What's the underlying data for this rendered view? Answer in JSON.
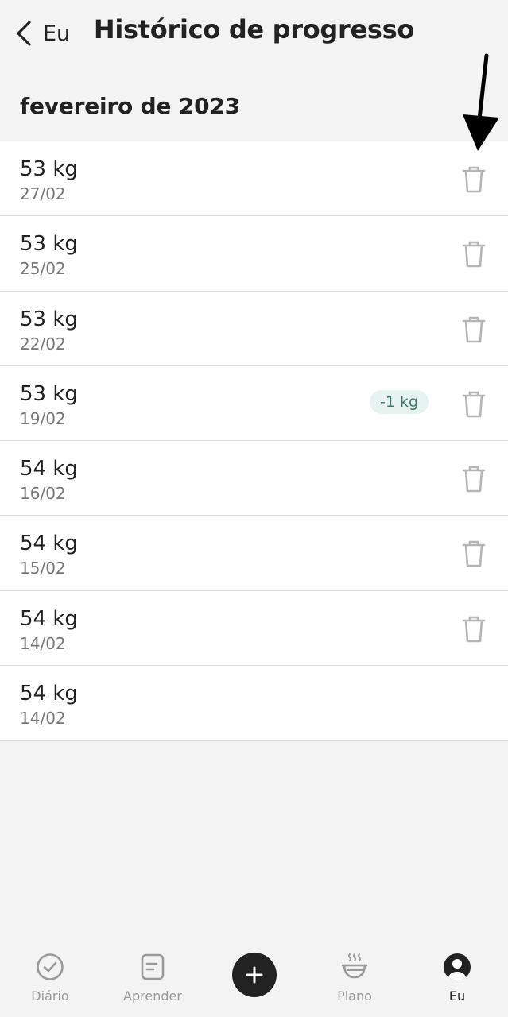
{
  "header": {
    "back_label": "Eu",
    "title": "Histórico de progresso"
  },
  "section": {
    "month": "fevereiro de 2023"
  },
  "entries": [
    {
      "weight": "53 kg",
      "date": "27/02",
      "badge": "",
      "deletable": true
    },
    {
      "weight": "53 kg",
      "date": "25/02",
      "badge": "",
      "deletable": true
    },
    {
      "weight": "53 kg",
      "date": "22/02",
      "badge": "",
      "deletable": true
    },
    {
      "weight": "53 kg",
      "date": "19/02",
      "badge": "-1 kg",
      "deletable": true
    },
    {
      "weight": "54 kg",
      "date": "16/02",
      "badge": "",
      "deletable": true
    },
    {
      "weight": "54 kg",
      "date": "15/02",
      "badge": "",
      "deletable": true
    },
    {
      "weight": "54 kg",
      "date": "14/02",
      "badge": "",
      "deletable": true
    },
    {
      "weight": "54 kg",
      "date": "14/02",
      "badge": "",
      "deletable": false
    }
  ],
  "tabbar": {
    "items": [
      {
        "label": "Diário",
        "icon": "check-circle-icon",
        "active": false
      },
      {
        "label": "Aprender",
        "icon": "note-icon",
        "active": false
      },
      {
        "label": "Plano",
        "icon": "bowl-icon",
        "active": false
      },
      {
        "label": "Eu",
        "icon": "user-icon",
        "active": true
      }
    ],
    "add_icon": "plus-icon"
  },
  "colors": {
    "background": "#f3f3f3",
    "badge_bg": "#e7f3f0",
    "badge_text": "#3c7a6c",
    "fab": "#222222",
    "inactive": "#9a9a9a"
  }
}
